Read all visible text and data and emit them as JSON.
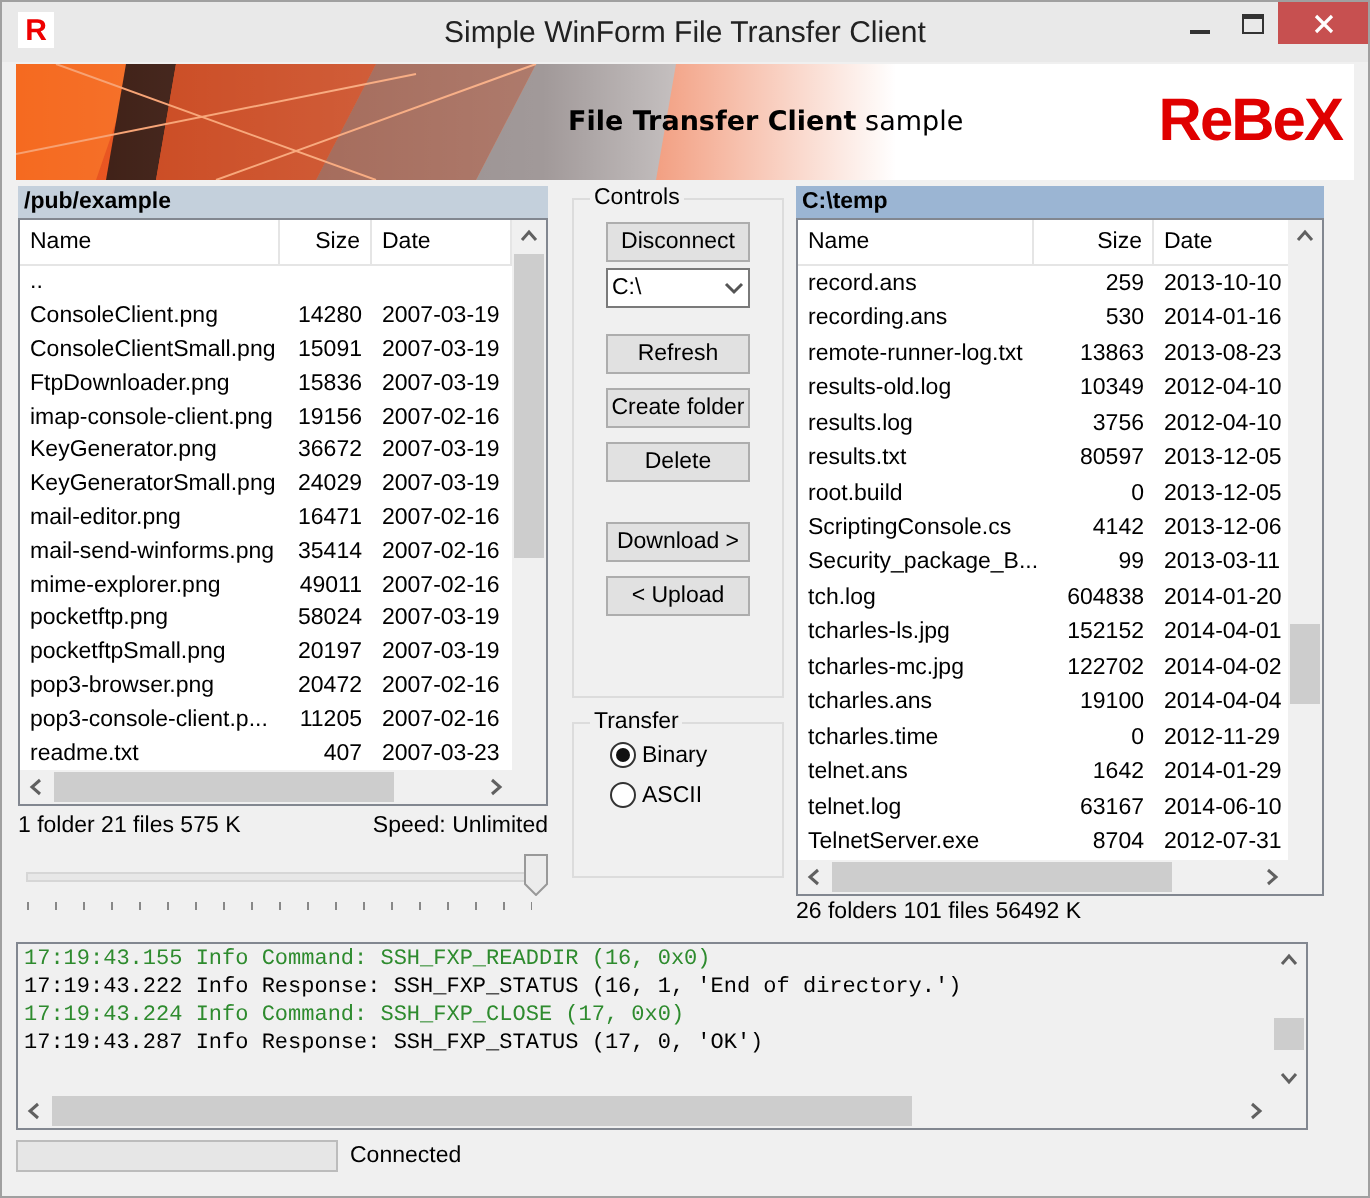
{
  "window": {
    "title": "Simple WinForm File Transfer Client",
    "app_icon": "R"
  },
  "banner": {
    "caption": "**File Transfer Client** sample",
    "logo": "ReBeX"
  },
  "remote_panel": {
    "path": "/pub/example",
    "active": false,
    "columns": [
      "Name",
      "Size",
      "Date"
    ],
    "rows": [
      {
        "name": "..",
        "size": "",
        "date": ""
      },
      {
        "name": "ConsoleClient.png",
        "size": "14280",
        "date": "2007-03-19"
      },
      {
        "name": "ConsoleClientSmall.png",
        "size": "15091",
        "date": "2007-03-19"
      },
      {
        "name": "FtpDownloader.png",
        "size": "15836",
        "date": "2007-03-19"
      },
      {
        "name": "imap-console-client.png",
        "size": "19156",
        "date": "2007-02-16"
      },
      {
        "name": "KeyGenerator.png",
        "size": "36672",
        "date": "2007-03-19"
      },
      {
        "name": "KeyGeneratorSmall.png",
        "size": "24029",
        "date": "2007-03-19"
      },
      {
        "name": "mail-editor.png",
        "size": "16471",
        "date": "2007-02-16"
      },
      {
        "name": "mail-send-winforms.png",
        "size": "35414",
        "date": "2007-02-16"
      },
      {
        "name": "mime-explorer.png",
        "size": "49011",
        "date": "2007-02-16"
      },
      {
        "name": "pocketftp.png",
        "size": "58024",
        "date": "2007-03-19"
      },
      {
        "name": "pocketftpSmall.png",
        "size": "20197",
        "date": "2007-03-19"
      },
      {
        "name": "pop3-browser.png",
        "size": "20472",
        "date": "2007-02-16"
      },
      {
        "name": "pop3-console-client.p...",
        "size": "11205",
        "date": "2007-02-16"
      },
      {
        "name": "readme.txt",
        "size": "407",
        "date": "2007-03-23"
      }
    ],
    "summary": "1 folder 21 files 575 K",
    "speed": "Speed: Unlimited",
    "speed_slider": {
      "level": 1
    }
  },
  "controls": {
    "title": "Controls",
    "disconnect": "Disconnect",
    "drive": "C:\\",
    "buttons": [
      "Refresh",
      "Create folder",
      "Delete"
    ],
    "transfer_buttons": [
      "Download >",
      "< Upload"
    ]
  },
  "transfer": {
    "title": "Transfer",
    "options": [
      {
        "label": "Binary",
        "selected": true
      },
      {
        "label": "ASCII",
        "selected": false
      }
    ]
  },
  "local_panel": {
    "path": "C:\\temp",
    "active": true,
    "columns": [
      "Name",
      "Size",
      "Date"
    ],
    "rows": [
      {
        "name": "record.ans",
        "size": "259",
        "date": "2013-10-10"
      },
      {
        "name": "recording.ans",
        "size": "530",
        "date": "2014-01-16"
      },
      {
        "name": "remote-runner-log.txt",
        "size": "13863",
        "date": "2013-08-23"
      },
      {
        "name": "results-old.log",
        "size": "10349",
        "date": "2012-04-10"
      },
      {
        "name": "results.log",
        "size": "3756",
        "date": "2012-04-10"
      },
      {
        "name": "results.txt",
        "size": "80597",
        "date": "2013-12-05"
      },
      {
        "name": "root.build",
        "size": "0",
        "date": "2013-12-05"
      },
      {
        "name": "ScriptingConsole.cs",
        "size": "4142",
        "date": "2013-12-06"
      },
      {
        "name": "Security_package_B...",
        "size": "99",
        "date": "2013-03-11"
      },
      {
        "name": "tch.log",
        "size": "604838",
        "date": "2014-01-20"
      },
      {
        "name": "tcharles-ls.jpg",
        "size": "152152",
        "date": "2014-04-01"
      },
      {
        "name": "tcharles-mc.jpg",
        "size": "122702",
        "date": "2014-04-02"
      },
      {
        "name": "tcharles.ans",
        "size": "19100",
        "date": "2014-04-04"
      },
      {
        "name": "tcharles.time",
        "size": "0",
        "date": "2012-11-29"
      },
      {
        "name": "telnet.ans",
        "size": "1642",
        "date": "2014-01-29"
      },
      {
        "name": "telnet.log",
        "size": "63167",
        "date": "2014-06-10"
      },
      {
        "name": "TelnetServer.exe",
        "size": "8704",
        "date": "2012-07-31"
      }
    ],
    "summary": "26 folders 101 files 56492 K"
  },
  "log": [
    {
      "kind": "command",
      "text": "17:19:43.155 Info Command: SSH_FXP_READDIR (16, 0x0)"
    },
    {
      "kind": "response",
      "text": "17:19:43.222 Info Response: SSH_FXP_STATUS (16, 1, 'End of directory.')"
    },
    {
      "kind": "command",
      "text": "17:19:43.224 Info Command: SSH_FXP_CLOSE (17, 0x0)"
    },
    {
      "kind": "response",
      "text": "17:19:43.287 Info Response: SSH_FXP_STATUS (17, 0, 'OK')"
    }
  ],
  "status_bar": {
    "progress": {
      "level": 0
    },
    "text": "Connected"
  }
}
